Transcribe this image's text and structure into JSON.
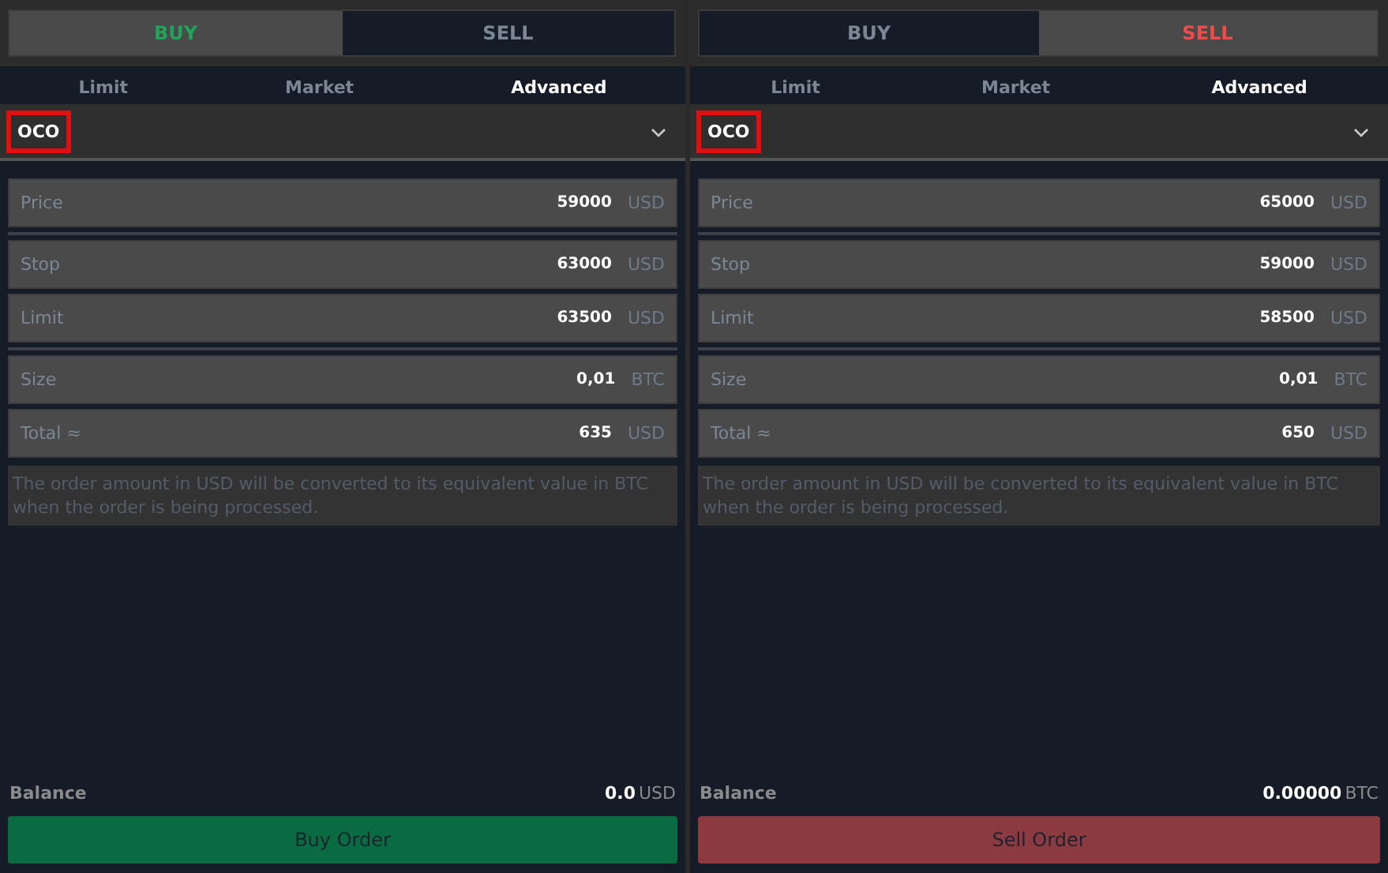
{
  "panels": [
    {
      "side_toggle": [
        {
          "label": "BUY",
          "kind": "buy",
          "selected": true
        },
        {
          "label": "SELL",
          "kind": "sell",
          "selected": false
        }
      ],
      "order_tabs": [
        {
          "label": "Limit",
          "selected": false
        },
        {
          "label": "Market",
          "selected": false
        },
        {
          "label": "Advanced",
          "selected": true
        }
      ],
      "order_type": {
        "value": "OCO",
        "highlighted": true
      },
      "field_groups": [
        [
          {
            "label": "Price",
            "value": "59000",
            "unit": "USD"
          }
        ],
        [
          {
            "label": "Stop",
            "value": "63000",
            "unit": "USD"
          },
          {
            "label": "Limit",
            "value": "63500",
            "unit": "USD"
          }
        ],
        [
          {
            "label": "Size",
            "value": "0,01",
            "unit": "BTC"
          },
          {
            "label": "Total ≈",
            "value": "635",
            "unit": "USD"
          }
        ]
      ],
      "note": "The order amount in USD will be converted to its equivalent value in BTC when the order is being processed.",
      "balance": {
        "label": "Balance",
        "amount": "0.0",
        "unit": "USD"
      },
      "submit": {
        "label": "Buy Order",
        "kind": "buy"
      }
    },
    {
      "side_toggle": [
        {
          "label": "BUY",
          "kind": "buy",
          "selected": false
        },
        {
          "label": "SELL",
          "kind": "sell",
          "selected": true
        }
      ],
      "order_tabs": [
        {
          "label": "Limit",
          "selected": false
        },
        {
          "label": "Market",
          "selected": false
        },
        {
          "label": "Advanced",
          "selected": true
        }
      ],
      "order_type": {
        "value": "OCO",
        "highlighted": true
      },
      "field_groups": [
        [
          {
            "label": "Price",
            "value": "65000",
            "unit": "USD"
          }
        ],
        [
          {
            "label": "Stop",
            "value": "59000",
            "unit": "USD"
          },
          {
            "label": "Limit",
            "value": "58500",
            "unit": "USD"
          }
        ],
        [
          {
            "label": "Size",
            "value": "0,01",
            "unit": "BTC"
          },
          {
            "label": "Total ≈",
            "value": "650",
            "unit": "USD"
          }
        ]
      ],
      "note": "The order amount in USD will be converted to its equivalent value in BTC when the order is being processed.",
      "balance": {
        "label": "Balance",
        "amount": "0.00000",
        "unit": "BTC"
      },
      "submit": {
        "label": "Sell Order",
        "kind": "sell"
      }
    }
  ]
}
